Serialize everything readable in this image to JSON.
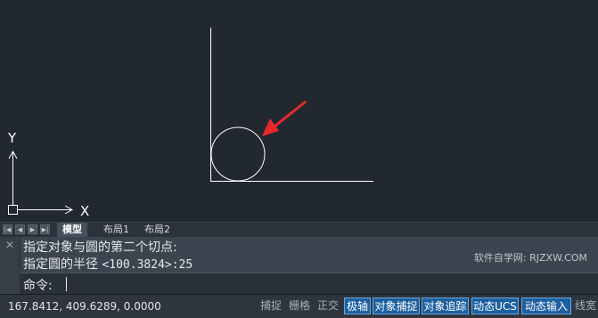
{
  "layout_tabs": [
    "模型",
    "布局1",
    "布局2"
  ],
  "axis": {
    "y_label": "Y",
    "x_label": "X"
  },
  "command": {
    "close_glyph": "✕",
    "history": [
      "指定对象与圆的第二个切点:",
      "指定圆的半径 ",
      "<100.3824>:25"
    ],
    "prompt": "命令:",
    "watermark": "软件自学网: RJZXW.COM"
  },
  "status": {
    "coords": "167.8412, 409.6289, 0.0000",
    "toggles": [
      {
        "label": "捕捉",
        "on": false
      },
      {
        "label": "栅格",
        "on": false
      },
      {
        "label": "正交",
        "on": false
      },
      {
        "label": "极轴",
        "on": true
      },
      {
        "label": "对象捕捉",
        "on": true
      },
      {
        "label": "对象追踪",
        "on": true
      },
      {
        "label": "动态UCS",
        "on": true
      },
      {
        "label": "动态输入",
        "on": true
      },
      {
        "label": "线宽",
        "on": false
      }
    ]
  },
  "colors": {
    "canvas": "#212830",
    "drawing_line": "#ffffff",
    "arrow": "#e8282b",
    "toggle_on": "#1b5fa0"
  }
}
